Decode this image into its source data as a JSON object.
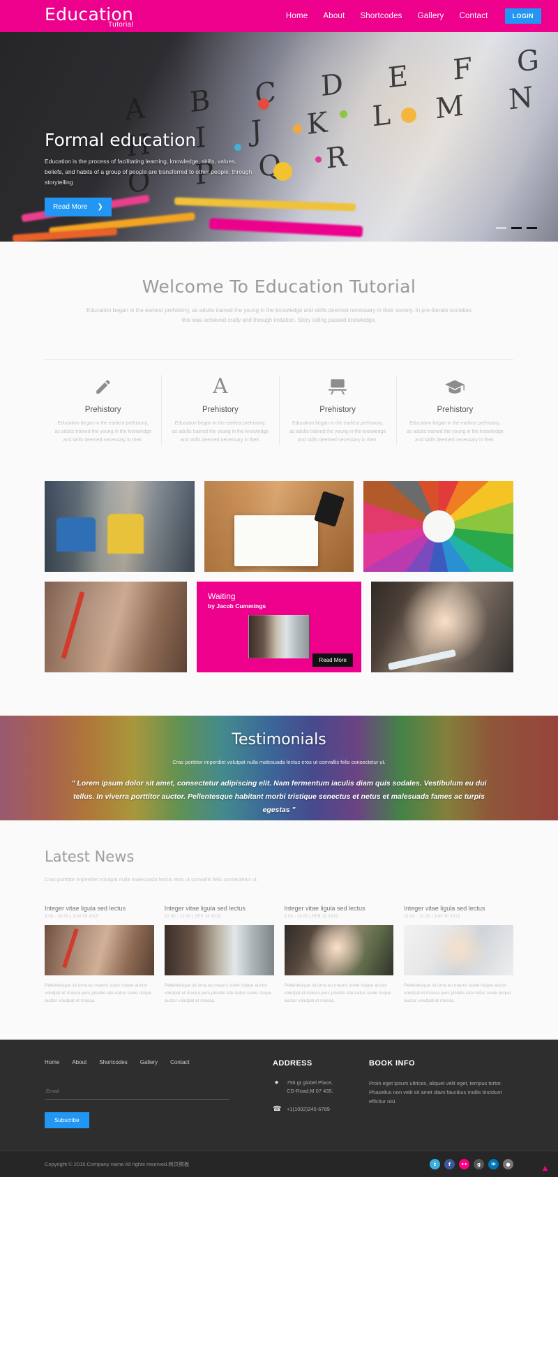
{
  "header": {
    "brand_title": "Education",
    "brand_sub": "Tutorial",
    "nav": [
      {
        "label": "Home"
      },
      {
        "label": "About"
      },
      {
        "label": "Shortcodes"
      },
      {
        "label": "Gallery"
      },
      {
        "label": "Contact"
      }
    ],
    "login_label": "LOGIN",
    "brand_color": "#ec008c",
    "accent_color": "#2196f3"
  },
  "hero": {
    "title": "Formal education",
    "text": "Education is the process of facilitating learning, knowledge, skills, values, beliefs, and habits of a group of people are transferred to other people, through storytelling",
    "button_label": "Read More",
    "button_icon": "chevron-right-icon",
    "letters": "A B C D E F G H I J K L M N O P Q R",
    "slides": 3,
    "active_slide": 3
  },
  "welcome": {
    "title": "Welcome To Education Tutorial",
    "subtitle": "Education began in the earliest prehistory, as adults trained the young in the knowledge and skills deemed necessary in their society. In pre-literate societies this was achieved orally and through imitation. Story telling passed knowledge.",
    "features": [
      {
        "icon": "pencil-icon",
        "title": "Prehistory",
        "text": "Education began in the earliest prehistory, as adults trained the young in the knowledge and skills deemed necessary in their."
      },
      {
        "icon": "letter-a-icon",
        "title": "Prehistory",
        "text": "Education began in the earliest prehistory, as adults trained the young in the knowledge and skills deemed necessary in their."
      },
      {
        "icon": "desk-monitor-icon",
        "title": "Prehistory",
        "text": "Education began in the earliest prehistory, as adults trained the young in the knowledge and skills deemed necessary in their."
      },
      {
        "icon": "graduation-cap-icon",
        "title": "Prehistory",
        "text": "Education began in the earliest prehistory, as adults trained the young in the knowledge and skills deemed necessary in their."
      }
    ]
  },
  "gallery": {
    "tiles": [
      {
        "name": "classroom-kids-computers"
      },
      {
        "name": "desk-notebook-phone-coffee"
      },
      {
        "name": "colored-pencils-circle"
      },
      {
        "name": "child-writing-pencil"
      },
      {
        "name": "child-writing-marker"
      }
    ],
    "feature_card": {
      "title": "Waiting",
      "author": "by Jacob Cummings",
      "button_label": "Read More",
      "bg_color": "#ec008c"
    }
  },
  "testimonials": {
    "title": "Testimonials",
    "subtitle": "Cras porttitor imperdiet volutpat nulla malesuada lectus eros ut convallis felis consectetur ut.",
    "quote": "\" Lorem ipsum dolor sit amet, consectetur adipiscing elit. Nam fermentum iaculis diam quis sodales. Vestibulum eu dui tellus. In viverra porttitor auctor. Pellentesque habitant morbi tristique senectus et netus et malesuada fames ac turpis egestas \""
  },
  "news": {
    "title": "Latest News",
    "subtitle": "Cras porttitor imperdiet volutpat nulla malesuada lectus eros ut convallis felis consectetur ut.",
    "items": [
      {
        "title": "Integer vitae ligula sed lectus",
        "date": "9.00 - 10.00 | JUN 09 2015",
        "text": "Pellentesque sit urna eu mauris scele risque auctor volutpat et massa pers piciatis iste natus scele risque auctor volutpat et massa.",
        "thumb": "child-writing-pencil"
      },
      {
        "title": "Integer vitae ligula sed lectus",
        "date": "10.00 - 12.00 | SEP 24 2015",
        "text": "Pellentesque sit urna eu mauris scele risque auctor volutpat et massa pers piciatis iste natus scele risque auctor volutpat et massa.",
        "thumb": "child-by-window"
      },
      {
        "title": "Integer vitae ligula sed lectus",
        "date": "9.00 - 10.00 | FEB 15 2015",
        "text": "Pellentesque sit urna eu mauris scele risque auctor volutpat et massa pers piciatis iste natus scele risque auctor volutpat et massa.",
        "thumb": "girl-writing-marker"
      },
      {
        "title": "Integer vitae ligula sed lectus",
        "date": "11.00 - 12.00 | JUN 30 2015",
        "text": "Pellentesque sit urna eu mauris scele risque auctor volutpat et massa pers piciatis iste natus scele risque auctor volutpat et massa.",
        "thumb": "boy-reading-book"
      }
    ]
  },
  "footer": {
    "nav": [
      {
        "label": "Home"
      },
      {
        "label": "About"
      },
      {
        "label": "Shortcodes"
      },
      {
        "label": "Gallery"
      },
      {
        "label": "Contact"
      }
    ],
    "email_placeholder": "Email",
    "subscribe_label": "Subscribe",
    "address_heading": "ADDRESS",
    "address_line": "756 gt globel Place,\nCD-Road,M 07 435.",
    "phone": "+1(1002)345-6789",
    "location_icon": "map-pin-icon",
    "phone_icon": "phone-icon",
    "book_heading": "BOOK INFO",
    "book_text": "Proin eget ipsum ultrices, aliquet velit eget, tempus tortor. Phasellus non velit sit amet diam faucibus mollis tincidunt efficitur nisi.",
    "copyright": "Copyright © 2015.Company name All rights reserved.网页模板",
    "socials": [
      {
        "name": "twitter-icon",
        "glyph": "t",
        "color": "#3ab0e0"
      },
      {
        "name": "facebook-icon",
        "glyph": "f",
        "color": "#3b5998"
      },
      {
        "name": "flickr-icon",
        "glyph": "••",
        "color": "#ff0084"
      },
      {
        "name": "google-plus-icon",
        "glyph": "g",
        "color": "#dd4b39"
      },
      {
        "name": "linkedin-icon",
        "glyph": "in",
        "color": "#0077b5"
      },
      {
        "name": "rss-icon",
        "glyph": "●",
        "color": "#ee802f"
      }
    ],
    "to_top_icon": "arrow-up-icon"
  }
}
